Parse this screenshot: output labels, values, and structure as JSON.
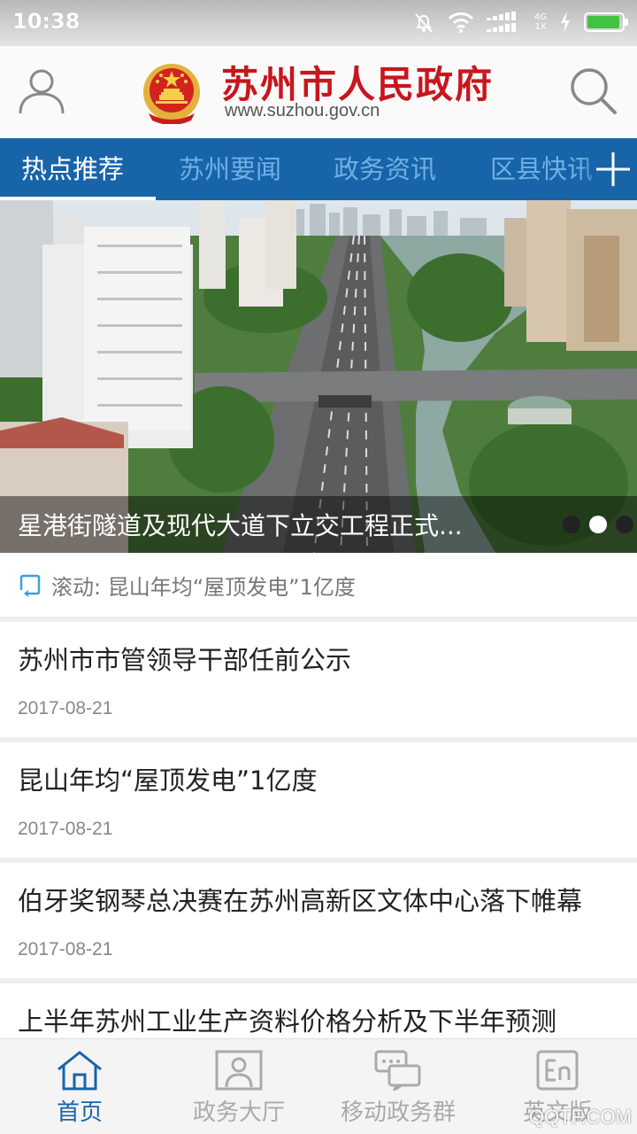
{
  "status_bar": {
    "time": "10:38",
    "network_top": "4G",
    "network_bottom": "1X"
  },
  "header": {
    "title": "苏州市人民政府",
    "url": "www.suzhou.gov.cn"
  },
  "tabs": [
    {
      "label": "热点推荐",
      "active": true
    },
    {
      "label": "苏州要闻",
      "active": false
    },
    {
      "label": "政务资讯",
      "active": false
    },
    {
      "label": "区县快讯",
      "active": false
    }
  ],
  "banner": {
    "caption": "星港街隧道及现代大道下立交工程正式...",
    "slides": 3,
    "current_slide": 2
  },
  "ticker": {
    "text": "滚动: 昆山年均“屋顶发电”1亿度"
  },
  "news": [
    {
      "title": "苏州市市管领导干部任前公示",
      "date": "2017-08-21"
    },
    {
      "title": "昆山年均“屋顶发电”1亿度",
      "date": "2017-08-21"
    },
    {
      "title": "伯牙奖钢琴总决赛在苏州高新区文体中心落下帷幕",
      "date": "2017-08-21"
    },
    {
      "title": "上半年苏州工业生产资料价格分析及下半年预测",
      "date": ""
    }
  ],
  "bottom_nav": [
    {
      "label": "首页",
      "icon": "home-icon",
      "active": true
    },
    {
      "label": "政务大厅",
      "icon": "portrait-icon",
      "active": false
    },
    {
      "label": "移动政务群",
      "icon": "chat-bubbles-icon",
      "active": false
    },
    {
      "label": "英文版",
      "icon": "english-icon",
      "active": false
    }
  ],
  "watermark": "QQTF.COM",
  "colors": {
    "brand_blue": "#1864a9",
    "title_red": "#c8161d",
    "tab_inactive": "#6fb0e3"
  }
}
